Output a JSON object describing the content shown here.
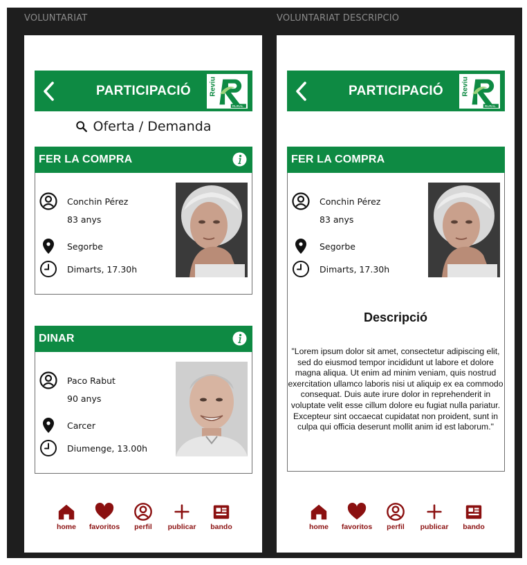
{
  "screens": [
    {
      "frame_label": "VOLUNTARIAT",
      "header": {
        "title": "PARTICIPACIÓ"
      },
      "search": {
        "label": "Oferta / Demanda"
      },
      "cards": [
        {
          "title": "FER LA COMPRA",
          "name": "Conchin Pérez",
          "age": "83 anys",
          "location": "Segorbe",
          "schedule": "Dimarts, 17.30h"
        },
        {
          "title": "DINAR",
          "name": "Paco Rabut",
          "age": "90 anys",
          "location": "Carcer",
          "schedule": "Diumenge, 13.00h"
        }
      ],
      "nav": [
        {
          "label": "home",
          "icon": "home-icon"
        },
        {
          "label": "favoritos",
          "icon": "heart-icon"
        },
        {
          "label": "perfil",
          "icon": "user-circle-icon"
        },
        {
          "label": "publicar",
          "icon": "plus-icon"
        },
        {
          "label": "bando",
          "icon": "news-icon"
        }
      ]
    },
    {
      "frame_label": "VOLUNTARIAT DESCRIPCIO",
      "header": {
        "title": "PARTICIPACIÓ"
      },
      "cards": [
        {
          "title": "FER LA COMPRA",
          "name": "Conchin Pérez",
          "age": "83 anys",
          "location": "Segorbe",
          "schedule": "Dimarts, 17.30h"
        }
      ],
      "description": {
        "title": "Descripció",
        "body": "\"Lorem ipsum dolor sit amet, consectetur adipiscing elit, sed do eiusmod tempor incididunt ut labore et dolore magna aliqua. Ut enim ad minim veniam, quis nostrud exercitation ullamco laboris nisi ut aliquip ex ea commodo consequat. Duis aute irure dolor in reprehenderit in voluptate velit esse cillum dolore eu fugiat nulla pariatur. Excepteur sint occaecat cupidatat non proident, sunt in culpa qui officia deserunt mollit anim id est laborum.\""
      },
      "nav": [
        {
          "label": "home",
          "icon": "home-icon"
        },
        {
          "label": "favoritos",
          "icon": "heart-icon"
        },
        {
          "label": "perfil",
          "icon": "user-circle-icon"
        },
        {
          "label": "publicar",
          "icon": "plus-icon"
        },
        {
          "label": "bando",
          "icon": "news-icon"
        }
      ]
    }
  ],
  "colors": {
    "primary_green": "#0e8a43",
    "nav_red": "#8b1010",
    "background": "#1e1e1e"
  }
}
